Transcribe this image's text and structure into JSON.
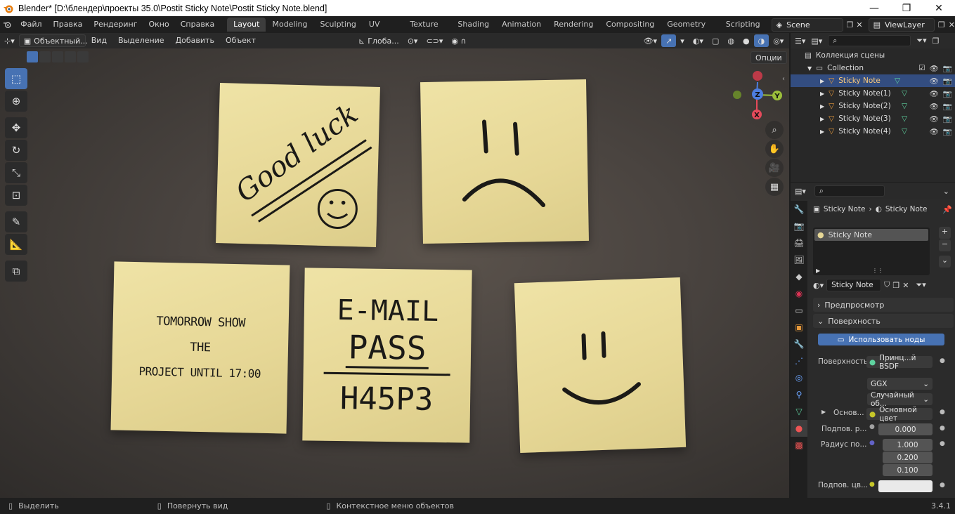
{
  "window": {
    "title": "Blender* [D:\\блендер\\проекты 35.0\\Postit Sticky Note\\Postit Sticky Note.blend]",
    "minimize": "—",
    "maximize": "❐",
    "close": "✕"
  },
  "menu": [
    "Файл",
    "Правка",
    "Рендеринг",
    "Окно",
    "Справка"
  ],
  "workspaces": [
    "Layout",
    "Modeling",
    "Sculpting",
    "UV Editing",
    "Texture Paint",
    "Shading",
    "Animation",
    "Rendering",
    "Compositing",
    "Geometry Nodes",
    "Scripting"
  ],
  "active_workspace": "Layout",
  "scene": "Scene",
  "view_layer": "ViewLayer",
  "viewport_header": {
    "mode": "Объектный...",
    "view": "Вид",
    "select": "Выделение",
    "add": "Добавить",
    "object": "Объект",
    "orientation": "Глоба...",
    "options": "Опции"
  },
  "notes": {
    "n1": {
      "line1": "Good luck"
    },
    "n4": {
      "line1": "TOMORROW SHOW",
      "line2": "THE",
      "line3": "PROJECT UNTIL 17:00"
    },
    "n5": {
      "line1": "E-MAIL",
      "line2": "PASS",
      "line3": "H45P3"
    }
  },
  "gizmo": {
    "x": "X",
    "y": "Y",
    "z": "Z"
  },
  "outliner": {
    "root": "Коллекция сцены",
    "collection": "Collection",
    "items": [
      "Sticky Note",
      "Sticky Note(1)",
      "Sticky Note(2)",
      "Sticky Note(3)",
      "Sticky Note(4)"
    ]
  },
  "properties": {
    "breadcrumb_object": "Sticky Note",
    "breadcrumb_material": "Sticky Note",
    "slot": "Sticky Note",
    "material_name": "Sticky Note",
    "preview": "Предпросмотр",
    "surface_panel": "Поверхность",
    "use_nodes": "Использовать ноды",
    "surface_label": "Поверхность",
    "surface_value": "Принц...й BSDF",
    "distribution": "GGX",
    "subsurface_method": "Случайный об...",
    "base_label": "Основ...",
    "base_value": "Основной цвет",
    "subsurface_label": "Подпов. р...",
    "subsurface_value": "0.000",
    "radius_label": "Радиус по...",
    "radius_values": [
      "1.000",
      "0.200",
      "0.100"
    ],
    "subsurface_color_label": "Подпов. цв..."
  },
  "statusbar": {
    "select": "Выделить",
    "rotate": "Повернуть вид",
    "context": "Контекстное меню объектов",
    "version": "3.4.1"
  },
  "colors": {
    "accent": "#4772b3",
    "note": "#e6d796",
    "selected_row": "#334d80"
  }
}
